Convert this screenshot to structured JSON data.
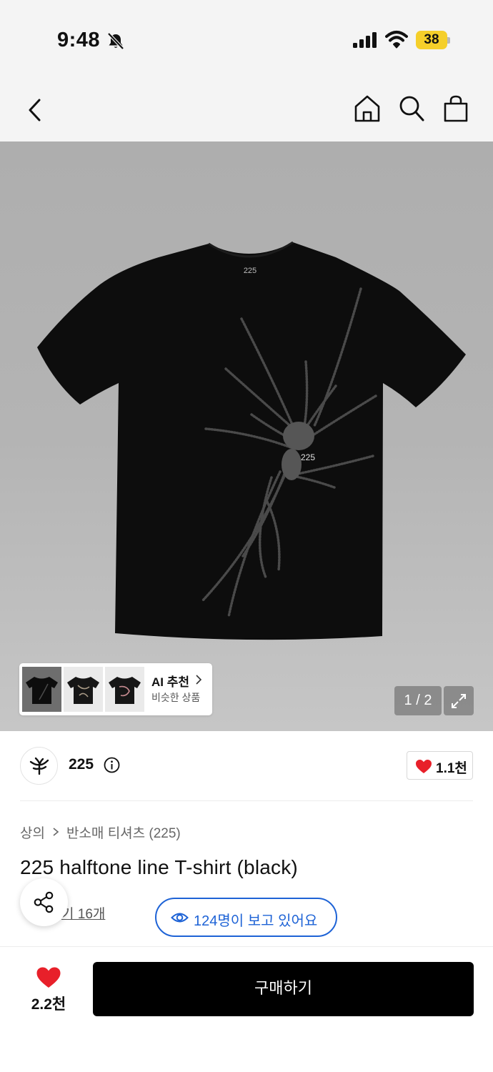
{
  "status_bar": {
    "time": "9:48",
    "battery_level": "38",
    "icons": [
      "bell-slash-icon",
      "signal-icon",
      "wifi-icon",
      "battery-icon"
    ]
  },
  "nav": {
    "icons": [
      "chevron-left-icon",
      "home-icon",
      "search-icon",
      "shopping-bag-icon"
    ]
  },
  "gallery": {
    "shirt_collar_label": "225",
    "shirt_print_label": "225",
    "page_counter": "1 / 2",
    "ai_recommend": {
      "title": "AI 추천",
      "subtitle": "비슷한 상품"
    }
  },
  "brand": {
    "name": "225",
    "like_count": "1.1천"
  },
  "breadcrumb": {
    "category": "상의",
    "subcategory": "반소매 티셔츠 (225)"
  },
  "product": {
    "title": "225 halftone line T-shirt (black)",
    "review_link": "기 16개",
    "viewers_text": "124명이 보고 있어요"
  },
  "bottom_bar": {
    "like_count": "2.2천",
    "buy_label": "구매하기"
  },
  "colors": {
    "accent_blue": "#1e63d6",
    "heart_red": "#e8202a",
    "battery_yellow": "#f5cf2a",
    "buy_button": "#000000"
  }
}
